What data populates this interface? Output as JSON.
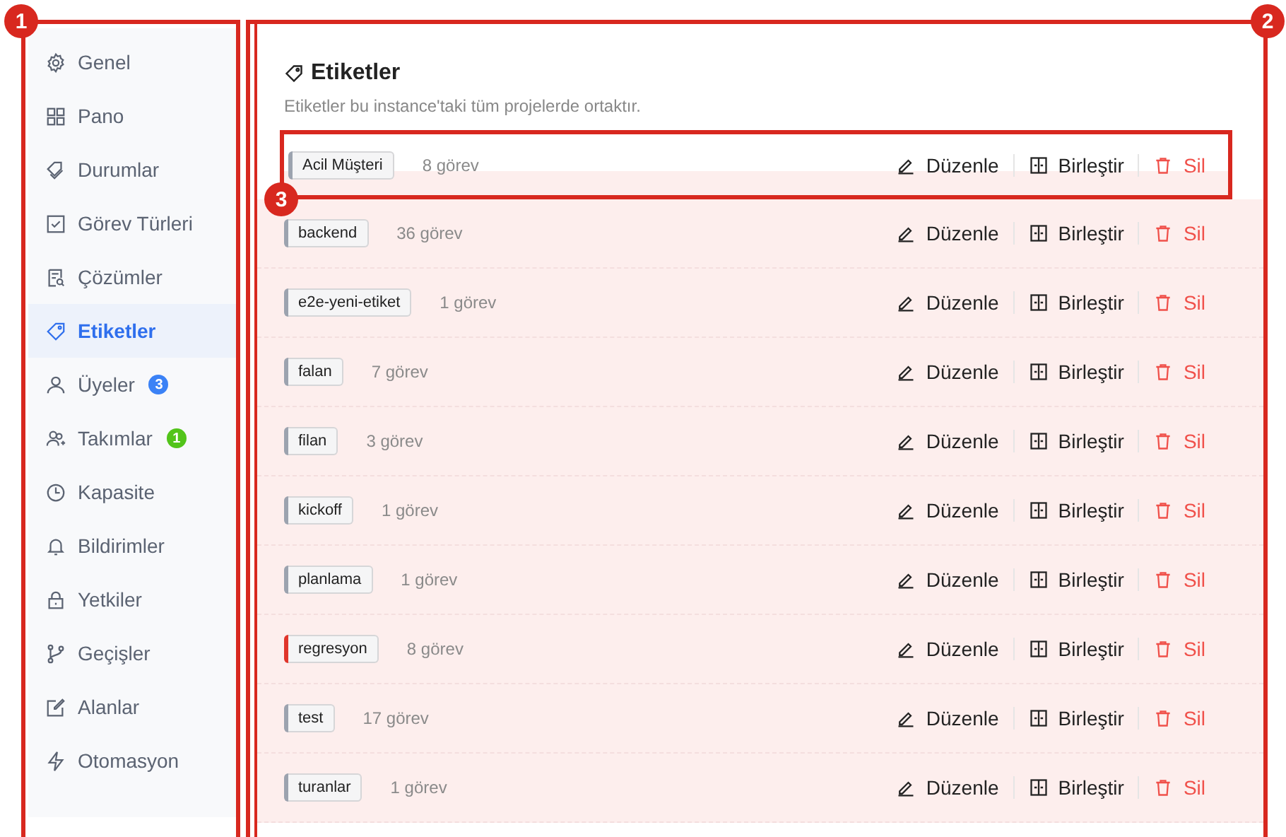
{
  "sidebar": {
    "annotation": "1",
    "items": [
      {
        "label": "Genel",
        "selected": false
      },
      {
        "label": "Pano",
        "selected": false
      },
      {
        "label": "Durumlar",
        "selected": false
      },
      {
        "label": "Görev Türleri",
        "selected": false
      },
      {
        "label": "Çözümler",
        "selected": false
      },
      {
        "label": "Etiketler",
        "selected": true
      },
      {
        "label": "Üyeler",
        "selected": false,
        "badge": {
          "text": "3",
          "color": "#3b82f6"
        }
      },
      {
        "label": "Takımlar",
        "selected": false,
        "badge": {
          "text": "1",
          "color": "#52c41a"
        }
      },
      {
        "label": "Kapasite",
        "selected": false
      },
      {
        "label": "Bildirimler",
        "selected": false
      },
      {
        "label": "Yetkiler",
        "selected": false
      },
      {
        "label": "Geçişler",
        "selected": false
      },
      {
        "label": "Alanlar",
        "selected": false
      },
      {
        "label": "Otomasyon",
        "selected": false
      }
    ]
  },
  "content": {
    "annotation": "2",
    "title": "Etiketler",
    "description": "Etiketler bu instance'taki tüm projelerde ortaktır.",
    "tags": [
      {
        "name": "Acil Müşteri",
        "count": "8 görev",
        "color": "#9ca3af",
        "highlighted": true,
        "annotation": "3",
        "edit": "Düzenle",
        "merge": "Birleştir",
        "delete": "Sil"
      },
      {
        "name": "backend",
        "count": "36 görev",
        "color": "#9ca3af",
        "highlighted": true,
        "edit": "Düzenle",
        "merge": "Birleştir",
        "delete": "Sil"
      },
      {
        "name": "e2e-yeni-etiket",
        "count": "1 görev",
        "color": "#9ca3af",
        "highlighted": true,
        "edit": "Düzenle",
        "merge": "Birleştir",
        "delete": "Sil"
      },
      {
        "name": "falan",
        "count": "7 görev",
        "color": "#9ca3af",
        "highlighted": true,
        "edit": "Düzenle",
        "merge": "Birleştir",
        "delete": "Sil"
      },
      {
        "name": "filan",
        "count": "3 görev",
        "color": "#9ca3af",
        "highlighted": true,
        "edit": "Düzenle",
        "merge": "Birleştir",
        "delete": "Sil"
      },
      {
        "name": "kickoff",
        "count": "1 görev",
        "color": "#9ca3af",
        "highlighted": true,
        "edit": "Düzenle",
        "merge": "Birleştir",
        "delete": "Sil"
      },
      {
        "name": "planlama",
        "count": "1 görev",
        "color": "#9ca3af",
        "highlighted": true,
        "edit": "Düzenle",
        "merge": "Birleştir",
        "delete": "Sil"
      },
      {
        "name": "regresyon",
        "count": "8 görev",
        "color": "#e0352b",
        "highlighted": true,
        "edit": "Düzenle",
        "merge": "Birleştir",
        "delete": "Sil"
      },
      {
        "name": "test",
        "count": "17 görev",
        "color": "#9ca3af",
        "highlighted": true,
        "edit": "Düzenle",
        "merge": "Birleştir",
        "delete": "Sil"
      },
      {
        "name": "turanlar",
        "count": "1 görev",
        "color": "#9ca3af",
        "highlighted": true,
        "edit": "Düzenle",
        "merge": "Birleştir",
        "delete": "Sil"
      }
    ]
  }
}
